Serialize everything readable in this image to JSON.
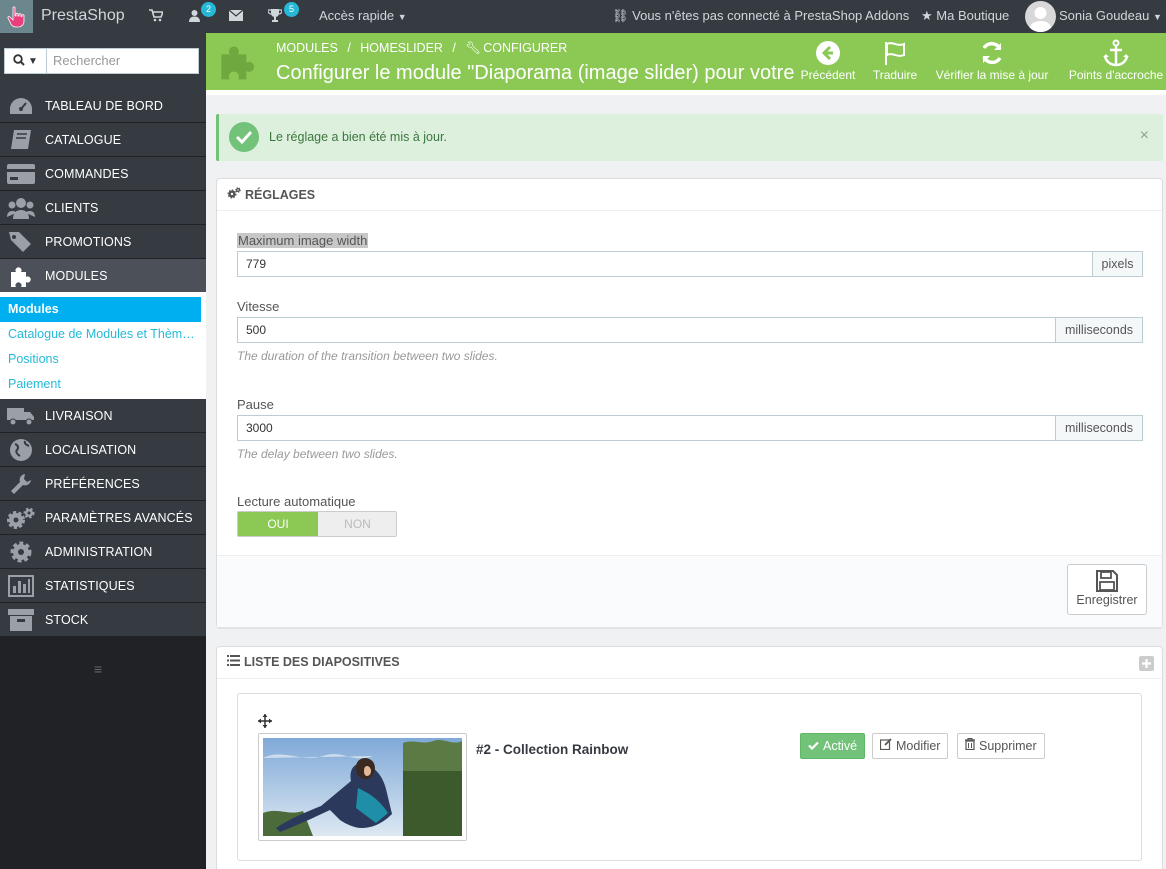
{
  "topbar": {
    "brand": "PrestaShop",
    "customers_badge": "2",
    "trophy_badge": "5",
    "quick_access": "Accès rapide",
    "addons_status": "Vous n'êtes pas connecté à PrestaShop Addons",
    "shop_link": "Ma Boutique",
    "user_name": "Sonia Goudeau"
  },
  "sidebar": {
    "search_placeholder": "Rechercher",
    "items": [
      {
        "label": "TABLEAU DE BORD",
        "icon": "dashboard-icon"
      },
      {
        "label": "CATALOGUE",
        "icon": "book-icon"
      },
      {
        "label": "COMMANDES",
        "icon": "credit-card-icon"
      },
      {
        "label": "CLIENTS",
        "icon": "users-icon"
      },
      {
        "label": "PROMOTIONS",
        "icon": "tag-icon"
      },
      {
        "label": "MODULES",
        "icon": "puzzle-icon"
      },
      {
        "label": "LIVRAISON",
        "icon": "truck-icon"
      },
      {
        "label": "LOCALISATION",
        "icon": "globe-icon"
      },
      {
        "label": "PRÉFÉRENCES",
        "icon": "wrench-icon"
      },
      {
        "label": "PARAMÈTRES AVANCÉS",
        "icon": "cogs-icon"
      },
      {
        "label": "ADMINISTRATION",
        "icon": "gear-icon"
      },
      {
        "label": "STATISTIQUES",
        "icon": "bar-chart-icon"
      },
      {
        "label": "STOCK",
        "icon": "archive-icon"
      }
    ],
    "subitems": [
      {
        "label": "Modules"
      },
      {
        "label": "Catalogue de Modules et Thèm…"
      },
      {
        "label": "Positions"
      },
      {
        "label": "Paiement"
      }
    ]
  },
  "header": {
    "breadcrumb": [
      "MODULES",
      "/",
      "HOMESLIDER",
      "/",
      "CONFIGURER"
    ],
    "title": "Configurer le module \"Diaporama (image slider) pour votre page d'accueil\"",
    "toolbar": {
      "back": "Précédent",
      "translate": "Traduire",
      "check_update": "Vérifier la mise à jour",
      "hooks": "Points d'accroche"
    }
  },
  "alert": {
    "message": "Le réglage a bien été mis à jour.",
    "close": "×"
  },
  "settings": {
    "heading": "RÉGLAGES",
    "max_width_label": "Maximum image width",
    "max_width_value": "779",
    "max_width_unit": "pixels",
    "speed_label": "Vitesse",
    "speed_value": "500",
    "speed_unit": "milliseconds",
    "speed_help": "The duration of the transition between two slides.",
    "pause_label": "Pause",
    "pause_value": "3000",
    "pause_unit": "milliseconds",
    "pause_help": "The delay between two slides.",
    "autoplay_label": "Lecture automatique",
    "autoplay_on": "OUI",
    "autoplay_off": "NON",
    "save_label": "Enregistrer"
  },
  "slides": {
    "heading": "LISTE DES DIAPOSITIVES",
    "items": [
      {
        "title": "#2 - Collection Rainbow",
        "status": "Activé",
        "edit": "Modifier",
        "delete": "Supprimer"
      }
    ]
  },
  "colors": {
    "header_green": "#8bc954",
    "sidebar_dark": "#363a41",
    "accent_blue": "#25b9d7",
    "success_green": "#72c279"
  }
}
